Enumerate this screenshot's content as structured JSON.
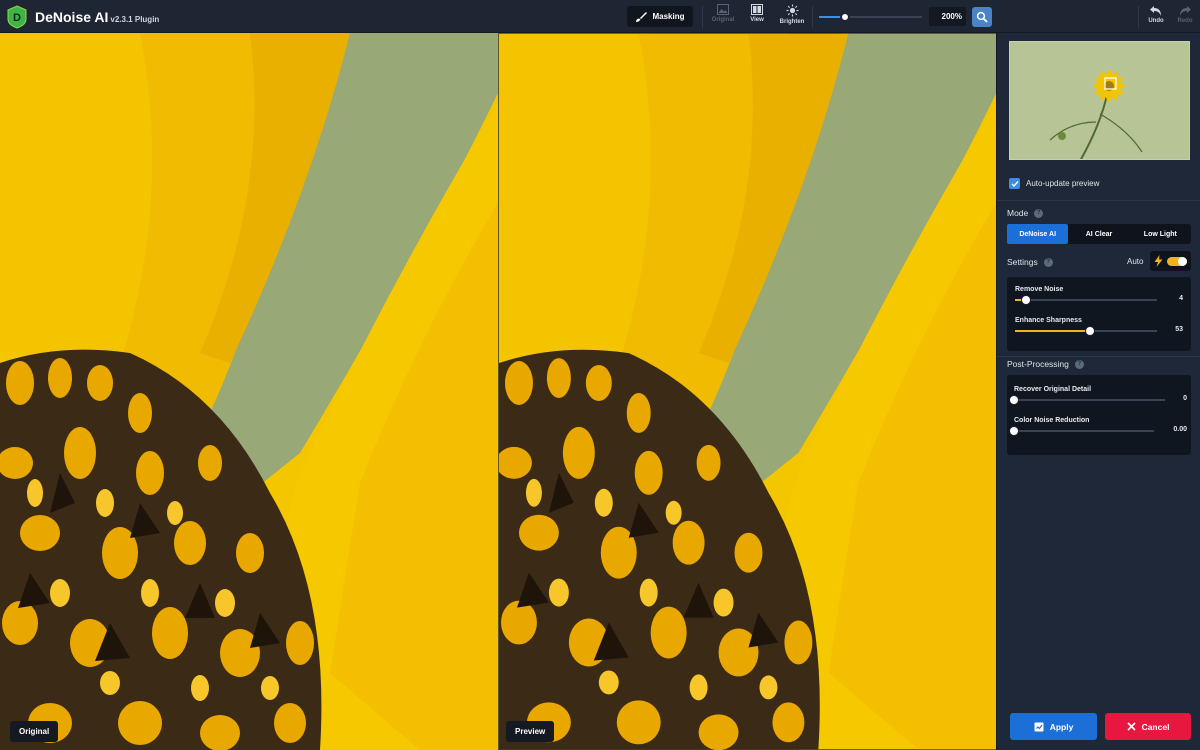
{
  "app": {
    "name": "DeNoise AI",
    "version": "v2.3.1 Plugin",
    "logo_letter": "D"
  },
  "toolbar": {
    "masking_label": "Masking",
    "original_label": "Original",
    "view_label": "View",
    "brighten_label": "Brighten",
    "zoom_value": "200%",
    "zoom_slider_fraction": 0.25,
    "undo_label": "Undo",
    "redo_label": "Redo"
  },
  "panes": {
    "left_label": "Original",
    "right_label": "Preview"
  },
  "panel": {
    "auto_update_label": "Auto-update preview",
    "auto_update_checked": true,
    "mode_title": "Mode",
    "modes": [
      {
        "label": "DeNoise AI",
        "active": true
      },
      {
        "label": "AI Clear",
        "active": false
      },
      {
        "label": "Low Light",
        "active": false
      }
    ],
    "settings_title": "Settings",
    "auto_label": "Auto",
    "auto_on": true,
    "settings": [
      {
        "name": "Remove Noise",
        "value": "4",
        "fraction": 0.08
      },
      {
        "name": "Enhance Sharpness",
        "value": "53",
        "fraction": 0.53
      }
    ],
    "post_title": "Post-Processing",
    "post": [
      {
        "name": "Recover Original Detail",
        "value": "0",
        "fraction": 0.0
      },
      {
        "name": "Color Noise Reduction",
        "value": "0.00",
        "fraction": 0.0
      }
    ],
    "apply_label": "Apply",
    "cancel_label": "Cancel"
  },
  "colors": {
    "accent_blue": "#1c6fd6",
    "slider_yellow": "#f0b21e",
    "cancel_red": "#e8173f",
    "panel_bg": "#1f2838",
    "topbar_bg": "#1e2533"
  },
  "icons": {
    "logo": "topaz-d-logo-icon",
    "masking": "brush-icon",
    "original": "image-icon",
    "view": "split-view-icon",
    "brighten": "sun-icon",
    "zoom": "magnifier-icon",
    "undo": "undo-arrow-icon",
    "redo": "redo-arrow-icon",
    "help": "question-circle-icon",
    "auto": "lightning-icon",
    "apply": "apply-icon",
    "cancel": "close-x-icon"
  }
}
